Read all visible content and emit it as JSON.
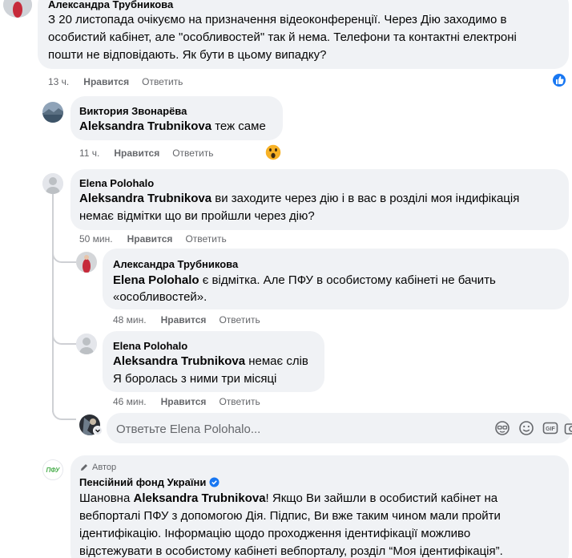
{
  "colors": {
    "bubble": "#f0f2f5",
    "meta": "#65676b",
    "like_badge": "#1877f2",
    "verified": "#1877f2",
    "thread_line": "#ced0d4"
  },
  "comment_top": {
    "author": "Александра Трубникова",
    "lines": [
      "З 20 листопада очікуємо на призначення відеоконференції. Через Дію заходимо в",
      "особистий кабінет, але \"особливостей\" так й нема. Телефони та контактні електроні",
      "пошти не відповідають. Як бути в цьому випадку?"
    ],
    "time": "13 ч.",
    "like": "Нравится",
    "reply": "Ответить",
    "reaction_icon": "like-reaction-icon"
  },
  "reply1": {
    "author": "Виктория Звонарёва",
    "mention": "Aleksandra Trubnikova",
    "text": " теж саме",
    "time": "11 ч.",
    "like": "Нравится",
    "reply": "Ответить",
    "reaction_icon": "wow-reaction-icon"
  },
  "reply2": {
    "author": "Elena Polohalo",
    "line1_mention": "Aleksandra Trubnikova",
    "line1_text": " ви заходите через дію і в вас в розділі моя індифікація",
    "line2": "немає відмітки що ви пройшли через дію?",
    "time": "50 мин.",
    "like": "Нравится",
    "reply": "Ответить"
  },
  "reply3": {
    "author": "Александра Трубникова",
    "line1_mention": "Elena Polohalo",
    "line1_text": " є відмітка. Але ПФУ в особистому кабінеті не бачить",
    "line2": "«особливостей».",
    "time": "48 мин.",
    "like": "Нравится",
    "reply": "Ответить"
  },
  "reply4": {
    "author": "Elena Polohalo",
    "line1_mention": "Aleksandra Trubnikova",
    "line1_text": " немає слів",
    "line2": "Я боролась з ними три місяці",
    "time": "46 мин.",
    "like": "Нравится",
    "reply": "Ответить"
  },
  "reply_input": {
    "placeholder": "Ответьте Elena Polohalo...",
    "tools": [
      "sticker-icon",
      "emoji-icon",
      "gif-icon",
      "camera-icon"
    ]
  },
  "author_reply": {
    "badge": "Автор",
    "author": "Пенсійний фонд України",
    "avatar_text": "ПФУ",
    "line1_prefix": "Шановна ",
    "line1_mention": "Aleksandra Trubnikova",
    "line1_text": "! Якщо Ви зайшли в особистий кабінет на",
    "line2": "вебпорталі ПФУ з допомогою Дія. Підпис, Ви вже таким чином мали пройти",
    "line3": "ідентифікацію. Інформацію щодо проходження ідентифікації можливо",
    "line4": "відстежувати в особистому кабінеті вебпорталу, розділ “Моя ідентифікація”."
  }
}
